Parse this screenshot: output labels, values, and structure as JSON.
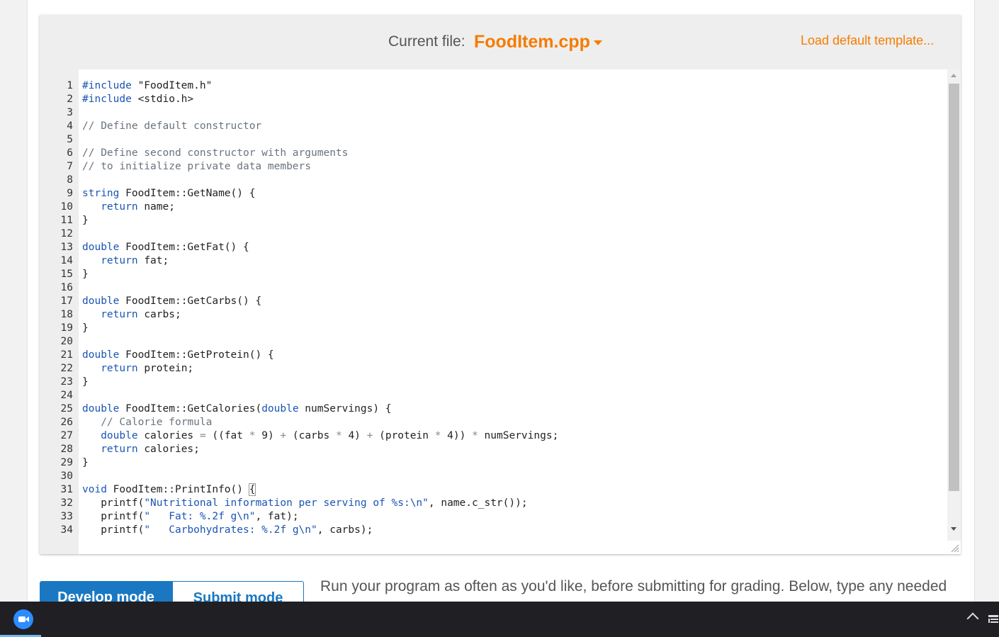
{
  "editor": {
    "current_file_label": "Current file:",
    "current_file_name": "FoodItem.cpp",
    "load_template_label": "Load default template..."
  },
  "line_count": 34,
  "code_lines": [
    "#include \"FoodItem.h\"",
    "#include <stdio.h>",
    "",
    "// Define default constructor",
    "",
    "// Define second constructor with arguments",
    "// to initialize private data members",
    "",
    "string FoodItem::GetName() {",
    "   return name;",
    "}",
    "",
    "double FoodItem::GetFat() {",
    "   return fat;",
    "}",
    "",
    "double FoodItem::GetCarbs() {",
    "   return carbs;",
    "}",
    "",
    "double FoodItem::GetProtein() {",
    "   return protein;",
    "}",
    "",
    "double FoodItem::GetCalories(double numServings) {",
    "   // Calorie formula",
    "   double calories = ((fat * 9) + (carbs * 4) + (protein * 4)) * numServings;",
    "   return calories;",
    "}",
    "",
    "void FoodItem::PrintInfo() {",
    "   printf(\"Nutritional information per serving of %s:\\n\", name.c_str());",
    "   printf(\"   Fat: %.2f g\\n\", fat);",
    "   printf(\"   Carbohydrates: %.2f g\\n\", carbs);"
  ],
  "modes": {
    "develop_label": "Develop mode",
    "submit_label": "Submit mode"
  },
  "instructions_text": "Run your program as often as you'd like, before submitting for grading. Below, type any needed",
  "colors": {
    "accent_orange": "#f57c00",
    "tab_blue": "#1a78c2",
    "keyword_blue": "#1a55b3",
    "taskbar": "#1f1f24"
  },
  "taskbar_icons": [
    "zoom-icon",
    "tray-chevron-up-icon",
    "tray-app-icon"
  ]
}
